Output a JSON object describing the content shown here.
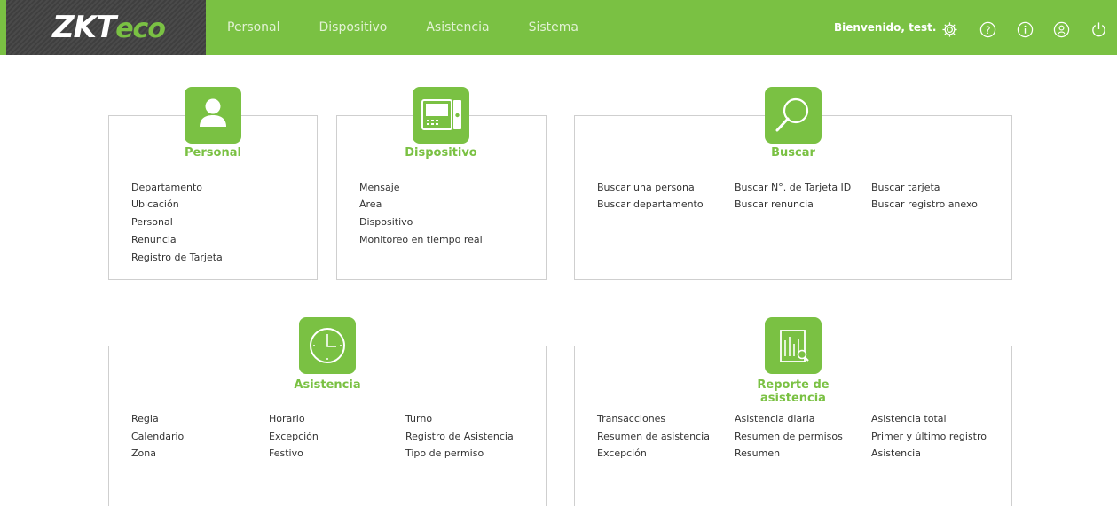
{
  "header": {
    "logo_main": "ZKT",
    "logo_suffix": "eco",
    "nav": [
      "Personal",
      "Dispositivo",
      "Asistencia",
      "Sistema"
    ],
    "welcome": "Bienvenido, test.",
    "icons": [
      "gear-icon",
      "help-icon",
      "info-icon",
      "user-icon",
      "power-icon"
    ],
    "accent": "#7ac143"
  },
  "panels": {
    "personal": {
      "title": "Personal",
      "icon": "person-icon",
      "links": [
        "Departamento",
        "Ubicación",
        "Personal",
        "Renuncia",
        "Registro de Tarjeta"
      ]
    },
    "dispositivo": {
      "title": "Dispositivo",
      "icon": "terminal-icon",
      "links": [
        "Mensaje",
        "Área",
        "Dispositivo",
        "Monitoreo en tiempo real"
      ]
    },
    "buscar": {
      "title": "Buscar",
      "icon": "search-icon",
      "links": [
        "Buscar una persona",
        "Buscar N°. de Tarjeta ID",
        "Buscar tarjeta",
        "Buscar departamento",
        "Buscar renuncia",
        "Buscar registro anexo"
      ]
    },
    "asistencia": {
      "title": "Asistencia",
      "icon": "clock-icon",
      "links": [
        "Regla",
        "Horario",
        "Turno",
        "Calendario",
        "Excepción",
        "Registro de Asistencia",
        "Zona",
        "Festivo",
        "Tipo de permiso"
      ]
    },
    "reporte": {
      "title_line1": "Reporte de",
      "title_line2": "asistencia",
      "icon": "report-icon",
      "links": [
        "Transacciones",
        "Asistencia diaria",
        "Asistencia total",
        "Resumen de asistencia",
        "Resumen de permisos",
        "Primer y último registro",
        "Excepción",
        "Resumen",
        "Asistencia"
      ]
    }
  }
}
